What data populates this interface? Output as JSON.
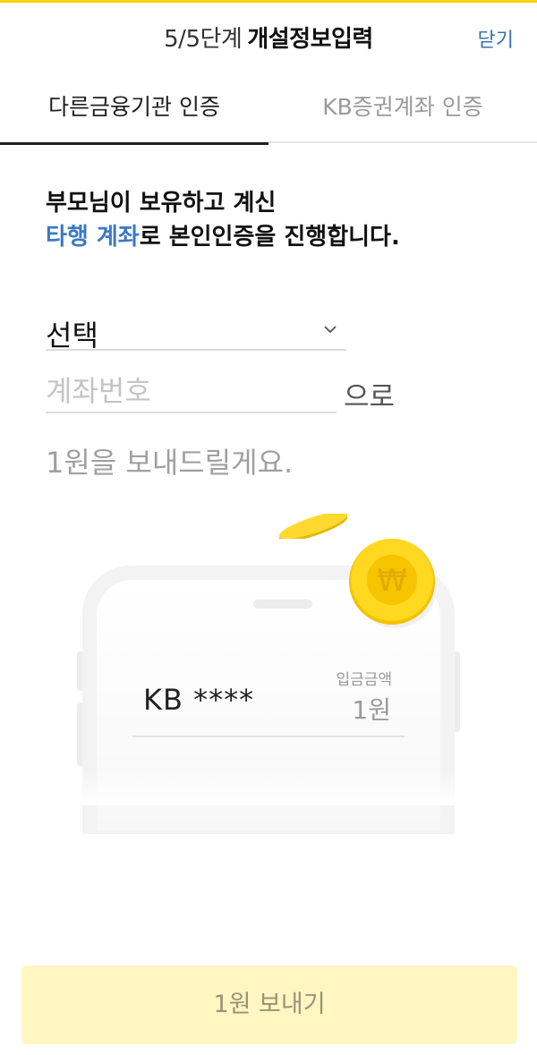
{
  "header": {
    "step": "5/5단계",
    "title": "개설정보입력",
    "close_label": "닫기"
  },
  "tabs": [
    {
      "label": "다른금융기관 인증",
      "active": true
    },
    {
      "label": "KB증권계좌 인증",
      "active": false
    }
  ],
  "intro": {
    "line1": "부모님이 보유하고 계신",
    "highlight": "타행 계좌",
    "line2_rest": "로 본인인증을 진행합니다."
  },
  "form": {
    "bank_select_value": "선택",
    "account_placeholder": "계좌번호",
    "account_value": "",
    "account_particle": "으로",
    "send_text": "1원을 보내드릴게요."
  },
  "illustration": {
    "bank_account": "KB ****",
    "deposit_label": "입금금액",
    "deposit_amount": "1원",
    "coin_symbol": "₩"
  },
  "footer": {
    "send_button_label": "1원 보내기"
  },
  "colors": {
    "accent_yellow": "#ffd400",
    "link_blue": "#3b6fb6",
    "highlight_blue": "#3b78c4",
    "button_bg": "#fff6c2",
    "coin": "#ffd21a"
  },
  "icons": {
    "dropdown": "chevron-down-icon",
    "coin": "won-coin-icon"
  }
}
